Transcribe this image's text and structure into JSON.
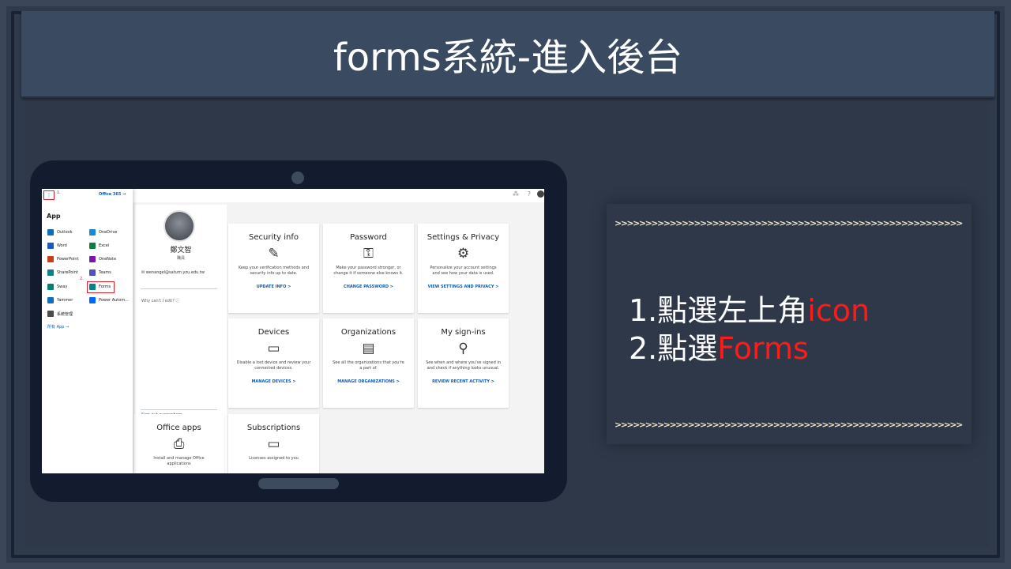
{
  "slide": {
    "title": "forms系統-進入後台",
    "instructions": {
      "line1_prefix": "1.點選左上角",
      "line1_highlight": "icon",
      "line2_prefix": "2.點選",
      "line2_highlight": "Forms"
    },
    "chevron_row": ">>>>>>>>>>>>>>>>>>>>>>>>>>>>>>>>>>>>>>>>>>>>>>>>>>>>>>>>>"
  },
  "launcher": {
    "step1": "1.",
    "step2": "2.",
    "office365_link": "Office 365 →",
    "heading": "App",
    "apps": [
      {
        "label": "Outlook",
        "color": "#0f6cbd"
      },
      {
        "label": "OneDrive",
        "color": "#1e86d6"
      },
      {
        "label": "Word",
        "color": "#185abd"
      },
      {
        "label": "Excel",
        "color": "#107c41"
      },
      {
        "label": "PowerPoint",
        "color": "#c43e1c"
      },
      {
        "label": "OneNote",
        "color": "#7719aa"
      },
      {
        "label": "SharePoint",
        "color": "#038387"
      },
      {
        "label": "Teams",
        "color": "#4b53bc"
      },
      {
        "label": "Sway",
        "color": "#008272"
      },
      {
        "label": "Forms",
        "color": "#038387"
      },
      {
        "label": "Yammer",
        "color": "#106ebe"
      },
      {
        "label": "Power Autom...",
        "color": "#0066ff"
      },
      {
        "label": "系統管理",
        "color": "#4a4a4a"
      }
    ],
    "all_apps": "所有 App →"
  },
  "profile": {
    "name": "鄭文智",
    "role": "職員",
    "email": "wenangel@saturn.yzu.edu.tw",
    "why_edit": "Why can't I edit? ⓘ",
    "sign_out": "Sign out everywhere"
  },
  "tiles": [
    {
      "title": "Security info",
      "icon": "✎",
      "desc": "Keep your verification methods and security info up to date.",
      "link": "UPDATE INFO  >"
    },
    {
      "title": "Password",
      "icon": "⚿",
      "desc": "Make your password stronger, or change it if someone else knows it.",
      "link": "CHANGE PASSWORD  >"
    },
    {
      "title": "Settings & Privacy",
      "icon": "⚙",
      "desc": "Personalize your account settings and see how your data is used.",
      "link": "VIEW SETTINGS AND PRIVACY  >"
    },
    {
      "title": "Devices",
      "icon": "▭",
      "desc": "Disable a lost device and review your connected devices.",
      "link": "MANAGE DEVICES  >"
    },
    {
      "title": "Organizations",
      "icon": "▤",
      "desc": "See all the organizations that you're a part of.",
      "link": "MANAGE ORGANIZATIONS  >"
    },
    {
      "title": "My sign-ins",
      "icon": "⚲",
      "desc": "See when and where you've signed in and check if anything looks unusual.",
      "link": "REVIEW RECENT ACTIVITY  >"
    },
    {
      "title": "Office apps",
      "icon": "⎙",
      "desc": "Install and manage Office applications",
      "link": ""
    },
    {
      "title": "Subscriptions",
      "icon": "▭",
      "desc": "Licenses assigned to you",
      "link": ""
    }
  ],
  "topbar": {
    "icon1": "⁂",
    "icon2": "?"
  }
}
